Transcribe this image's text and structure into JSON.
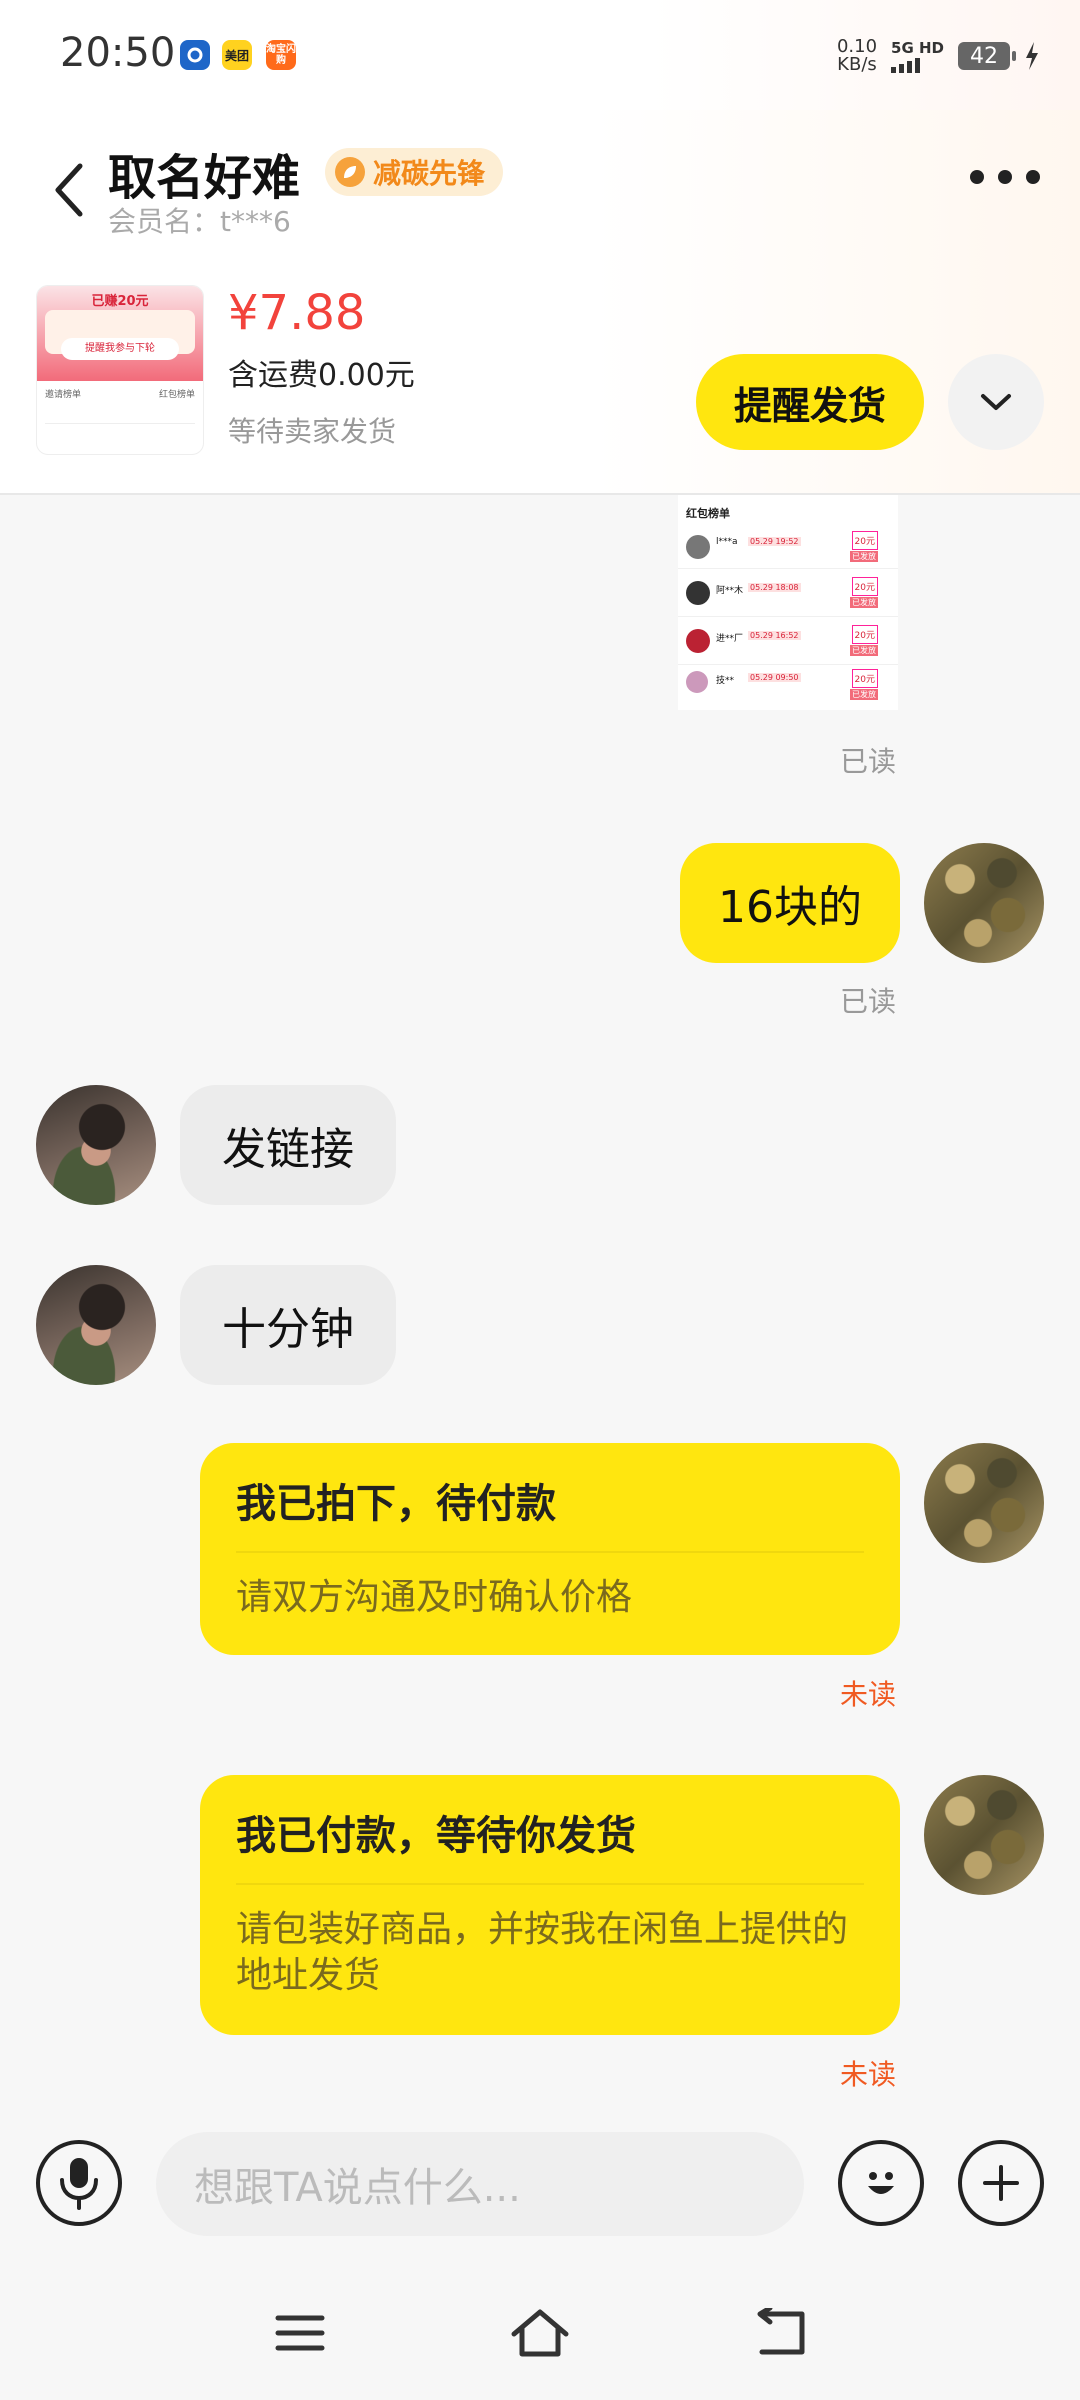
{
  "status_bar": {
    "time": "20:50",
    "app_icons": [
      {
        "name": "chain-icon",
        "color": "#1e66c8",
        "label": ""
      },
      {
        "name": "meituan-icon",
        "color": "#ffd21f",
        "label": "美团"
      },
      {
        "name": "taobao-flash-icon",
        "color": "#ff6a1a",
        "label": "淘宝闪购"
      }
    ],
    "net_speed_value": "0.10",
    "net_speed_unit": "KB/s",
    "network": "5G HD",
    "battery": "42"
  },
  "header": {
    "contact_name": "取名好难",
    "badge_label": "减碳先锋",
    "member_label": "会员名：t***6",
    "product": {
      "thumb_banner": "已赚20元",
      "thumb_button": "提醒我参与下轮",
      "thumb_row_left": "邀请榜单",
      "thumb_row_right": "红包榜单",
      "price": "¥7.88",
      "shipping": "含运费0.00元",
      "status": "等待卖家发货"
    },
    "remind_button": "提醒发货"
  },
  "messages": {
    "screenshot": {
      "title": "红包榜单",
      "rows": [
        {
          "name": "l***a",
          "tag": "05.29 19:52",
          "amount": "20元",
          "state": "已发放"
        },
        {
          "name": "阿**木",
          "tag": "05.29 18:08",
          "amount": "20元",
          "state": "已发放"
        },
        {
          "name": "进**厂",
          "tag": "05.29 16:52",
          "amount": "20元",
          "state": "已发放"
        },
        {
          "name": "技**",
          "tag": "05.29 09:50",
          "amount": "20元",
          "state": "已发放"
        }
      ]
    },
    "read_label": "已读",
    "unread_label": "未读",
    "msg1": "16块的",
    "msg2": "发链接",
    "msg3": "十分钟",
    "card1_title": "我已拍下，待付款",
    "card1_body": "请双方沟通及时确认价格",
    "card2_title": "我已付款，等待你发货",
    "card2_body": "请包装好商品，并按我在闲鱼上提供的地址发货"
  },
  "input": {
    "placeholder": "想跟TA说点什么..."
  },
  "colors": {
    "accent_yellow": "#ffe60f",
    "price_red": "#f2433c",
    "unread_orange": "#f05a22",
    "badge_orange": "#f2891a"
  }
}
